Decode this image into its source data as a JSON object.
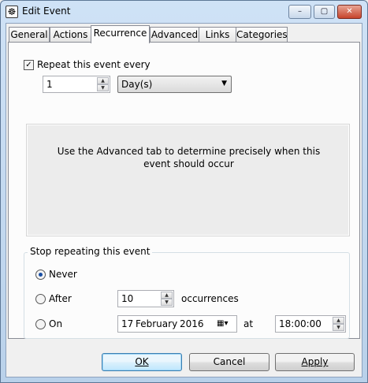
{
  "window": {
    "title": "Edit Event",
    "icon": "app-icon",
    "controls": {
      "minimize": "–",
      "maximize": "▢",
      "close": "✕"
    }
  },
  "tabs": [
    {
      "label": "General",
      "active": false
    },
    {
      "label": "Actions",
      "active": false
    },
    {
      "label": "Recurrence",
      "active": true
    },
    {
      "label": "Advanced",
      "active": false
    },
    {
      "label": "Links",
      "active": false
    },
    {
      "label": "Categories",
      "active": false
    }
  ],
  "recurrence": {
    "repeat_label": "Repeat this event every",
    "repeat_checked": true,
    "interval_value": "1",
    "unit_value": "Day(s)",
    "info_text": "Use the Advanced tab to determine precisely when this event should occur"
  },
  "stop": {
    "title": "Stop repeating this event",
    "never_label": "Never",
    "never_checked": true,
    "after_label": "After",
    "after_count": "10",
    "occurrences_label": "occurrences",
    "on_label": "On",
    "date_day": "17",
    "date_month": "February",
    "date_year": "2016",
    "at_label": "at",
    "time_value": "18:00:00"
  },
  "buttons": {
    "ok": "OK",
    "cancel": "Cancel",
    "apply": "Apply"
  }
}
